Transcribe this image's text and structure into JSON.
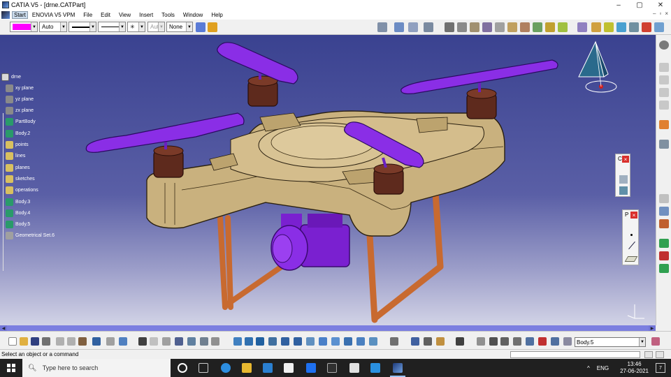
{
  "window": {
    "title": "CATIA V5 - [drne.CATPart]",
    "controls": [
      "–",
      "▢",
      "✕"
    ]
  },
  "menu": {
    "items": [
      "Start",
      "ENOVIA V5 VPM",
      "File",
      "Edit",
      "View",
      "Insert",
      "Tools",
      "Window",
      "Help"
    ],
    "mdi_controls": [
      "–",
      "▫",
      "×"
    ]
  },
  "toolbar1": {
    "fill_color": "#ff00ff",
    "color_mode": "Auto",
    "line_thickness_label": "",
    "line_type_label": "",
    "point_symbol": "✳",
    "layer_value": "Aut",
    "render_value": "None"
  },
  "spec_tree": {
    "root": "drne",
    "items": [
      {
        "label": "xy plane",
        "icon": "plane-icon"
      },
      {
        "label": "yz plane",
        "icon": "plane-icon"
      },
      {
        "label": "zx plane",
        "icon": "plane-icon"
      },
      {
        "label": "PartBody",
        "icon": "body-icon"
      },
      {
        "label": "Body.2",
        "icon": "body-icon"
      },
      {
        "label": "points",
        "icon": "geo-set-icon"
      },
      {
        "label": "lines",
        "icon": "geo-set-icon"
      },
      {
        "label": "planes",
        "icon": "geo-set-icon"
      },
      {
        "label": "sketches",
        "icon": "geo-set-icon"
      },
      {
        "label": "operations",
        "icon": "geo-set-icon"
      },
      {
        "label": "Body.3",
        "icon": "body-icon"
      },
      {
        "label": "Body.4",
        "icon": "body-icon"
      },
      {
        "label": "Body.5",
        "icon": "body-icon"
      },
      {
        "label": "Geometrical Set.6",
        "icon": "geometrical-set-icon"
      }
    ]
  },
  "floating_panels": [
    {
      "title": "C",
      "icons": [
        "surface-icon",
        "cube-icon"
      ]
    },
    {
      "title": "P",
      "icons": [
        "point-icon",
        "line-icon",
        "plane-icon"
      ]
    }
  ],
  "bottom_toolbar": {
    "current_body": "Body.5"
  },
  "status": {
    "message": "Select an object or a command"
  },
  "taskbar": {
    "search_placeholder": "Type here to search",
    "language": "ENG",
    "time": "13:46",
    "date": "27-06-2021",
    "notification_count": "7"
  },
  "colors": {
    "viewport_top": "#3a4290",
    "drone_body": "#c9b17e",
    "propeller": "#8a2ee6",
    "motor": "#5e2a1d",
    "leg": "#c86a30",
    "camera": "#8a2ee6"
  }
}
